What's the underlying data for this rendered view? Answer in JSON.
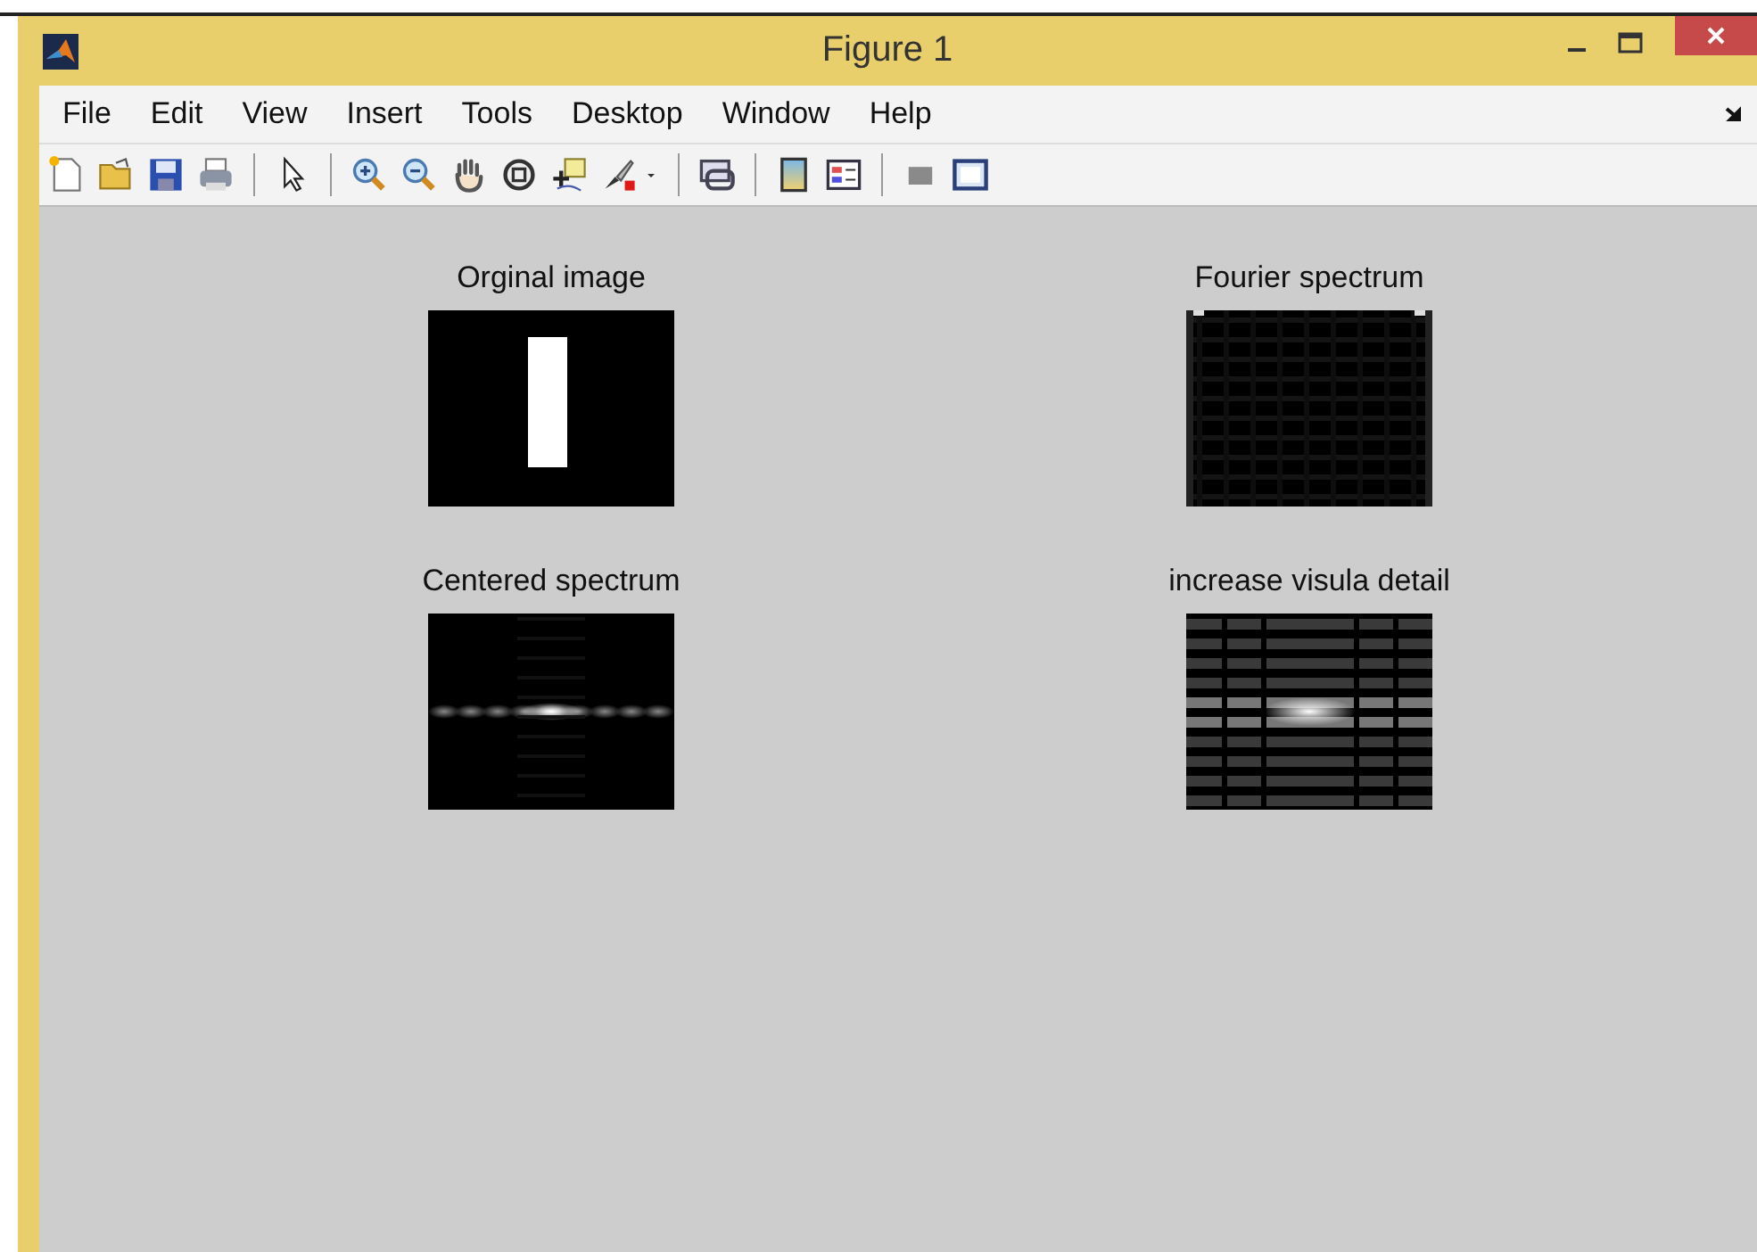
{
  "window": {
    "title": "Figure 1"
  },
  "menu": [
    "File",
    "Edit",
    "View",
    "Insert",
    "Tools",
    "Desktop",
    "Window",
    "Help"
  ],
  "subplots": [
    {
      "title": "Orginal image",
      "kind": "rectangle"
    },
    {
      "title": "Fourier spectrum",
      "kind": "spectrum"
    },
    {
      "title": "Centered spectrum",
      "kind": "centered"
    },
    {
      "title": "increase visula detail",
      "kind": "enhanced"
    }
  ]
}
